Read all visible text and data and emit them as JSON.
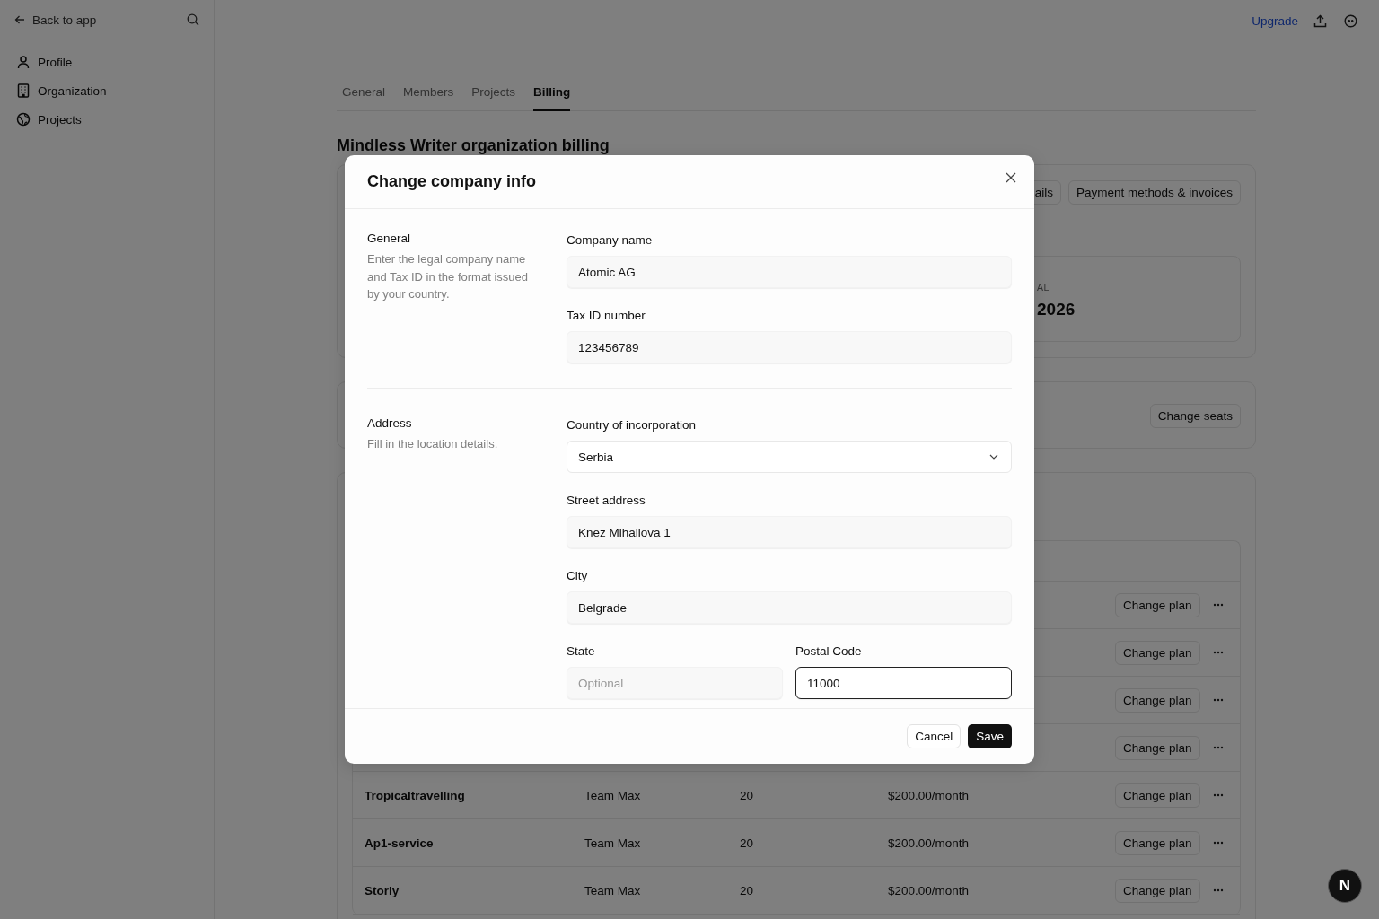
{
  "sidebar": {
    "back": "Back to app",
    "items": [
      {
        "label": "Profile"
      },
      {
        "label": "Organization"
      },
      {
        "label": "Projects"
      }
    ]
  },
  "topbar": {
    "upgrade": "Upgrade"
  },
  "tabs": [
    {
      "label": "General",
      "selected": false
    },
    {
      "label": "Members",
      "selected": false
    },
    {
      "label": "Projects",
      "selected": false
    },
    {
      "label": "Billing",
      "selected": true
    }
  ],
  "heading": "Mindless Writer organization billing",
  "billing_card": {
    "buttons": [
      "ails",
      "Payment methods & invoices"
    ],
    "renewal_label": "AL",
    "renewal_value": "2026"
  },
  "seats_card": {
    "button": "Change seats"
  },
  "projects_table": {
    "rows": [
      {
        "action": "Change plan"
      },
      {
        "action": "Change plan"
      },
      {
        "action": "Change plan"
      },
      {
        "action": "Change plan"
      },
      {
        "name": "Tropicaltravelling",
        "plan": "Team Max",
        "seats": "20",
        "price": "$200.00/month",
        "action": "Change plan"
      },
      {
        "name": "Ap1-service",
        "plan": "Team Max",
        "seats": "20",
        "price": "$200.00/month",
        "action": "Change plan"
      },
      {
        "name": "Storly",
        "plan": "Team Max",
        "seats": "20",
        "price": "$200.00/month",
        "action": "Change plan"
      }
    ]
  },
  "dialog": {
    "title": "Change company info",
    "sections": [
      {
        "title": "General",
        "description": "Enter the legal company name and Tax ID in the format issued by your country.",
        "rows": [
          {
            "fields": [
              {
                "kind": "text",
                "label": "Company name",
                "value": "Atomic AG",
                "focused": false
              }
            ]
          },
          {
            "fields": [
              {
                "kind": "text",
                "label": "Tax ID number",
                "value": "123456789",
                "focused": false
              }
            ]
          }
        ]
      },
      {
        "title": "Address",
        "description": "Fill in the location details.",
        "rows": [
          {
            "fields": [
              {
                "kind": "select",
                "label": "Country of incorporation",
                "value": "Serbia",
                "focused": false
              }
            ]
          },
          {
            "fields": [
              {
                "kind": "text",
                "label": "Street address",
                "value": "Knez Mihailova 1",
                "focused": false
              }
            ]
          },
          {
            "fields": [
              {
                "kind": "text",
                "label": "City",
                "value": "Belgrade",
                "focused": false
              }
            ]
          },
          {
            "fields": [
              {
                "kind": "text",
                "label": "State",
                "placeholder": "Optional",
                "focused": false
              },
              {
                "kind": "text",
                "label": "Postal Code",
                "value": "11000",
                "focused": true
              }
            ]
          }
        ]
      }
    ],
    "cancel": "Cancel",
    "save": "Save"
  },
  "badge": "N"
}
